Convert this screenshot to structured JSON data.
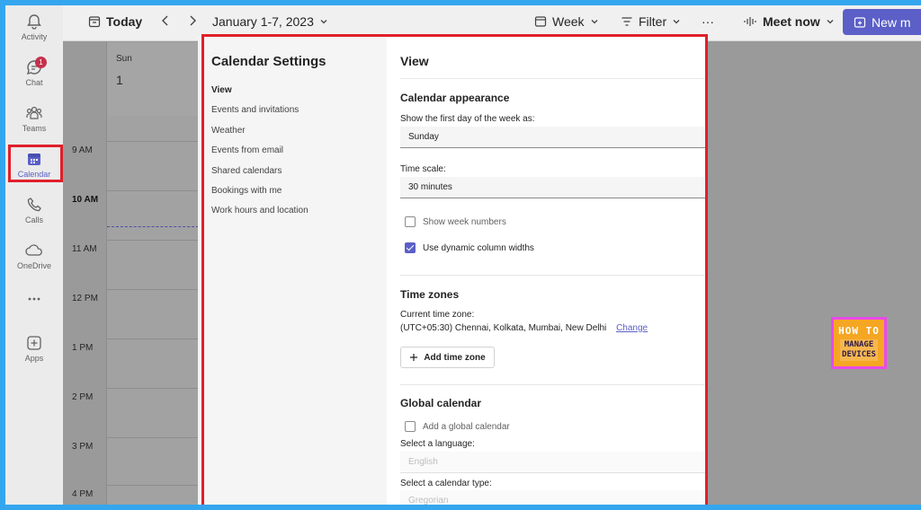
{
  "rail": {
    "items": [
      {
        "label": "Activity",
        "icon": "bell-icon"
      },
      {
        "label": "Chat",
        "icon": "chat-icon",
        "badge": "1"
      },
      {
        "label": "Teams",
        "icon": "teams-icon"
      },
      {
        "label": "Calendar",
        "icon": "calendar-icon"
      },
      {
        "label": "Calls",
        "icon": "phone-icon"
      },
      {
        "label": "OneDrive",
        "icon": "cloud-icon"
      },
      {
        "label": "",
        "icon": "more-icon"
      },
      {
        "label": "Apps",
        "icon": "apps-plus-icon"
      }
    ],
    "active": "Calendar"
  },
  "toolbar": {
    "today_label": "Today",
    "date_range": "January 1-7, 2023",
    "view_label": "Week",
    "filter_label": "Filter",
    "more_label": "···",
    "meet_now_label": "Meet now",
    "new_label": "New m"
  },
  "calendar": {
    "day_name": "Sun",
    "day_number": "1",
    "time_labels": [
      "9 AM",
      "10 AM",
      "11 AM",
      "12 PM",
      "1 PM",
      "2 PM",
      "3 PM",
      "4 PM"
    ],
    "current_time_label": "10 AM"
  },
  "settings": {
    "title": "Calendar Settings",
    "nav": [
      "View",
      "Events and invitations",
      "Weather",
      "Events from email",
      "Shared calendars",
      "Bookings with me",
      "Work hours and location"
    ],
    "active_nav": "View",
    "content_title": "View",
    "appearance": {
      "title": "Calendar appearance",
      "first_day_label": "Show the first day of the week as:",
      "first_day_value": "Sunday",
      "time_scale_label": "Time scale:",
      "time_scale_value": "30 minutes",
      "show_week_numbers": {
        "label": "Show week numbers",
        "checked": false
      },
      "dynamic_widths": {
        "label": "Use dynamic column widths",
        "checked": true
      }
    },
    "time_zones": {
      "title": "Time zones",
      "current_label": "Current time zone:",
      "current_value": "(UTC+05:30) Chennai, Kolkata, Mumbai, New Delhi",
      "change_label": "Change",
      "add_label": "Add time zone"
    },
    "global_calendar": {
      "title": "Global calendar",
      "add_label": "Add a global calendar",
      "language_label": "Select a language:",
      "language_value": "English",
      "type_label": "Select a calendar type:",
      "type_value": "Gregorian"
    }
  },
  "watermark": {
    "line1": "HOW TO",
    "line2": "MANAGE\nDEVICES"
  },
  "colors": {
    "accent": "#5b5fc7",
    "highlight": "#e0202a",
    "frame": "#34a6ee"
  }
}
